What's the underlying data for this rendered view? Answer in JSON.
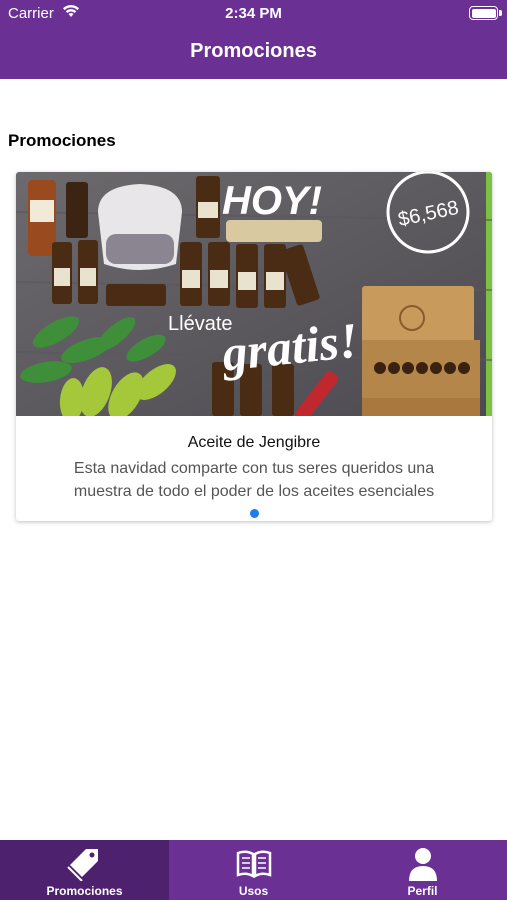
{
  "status_bar": {
    "carrier": "Carrier",
    "time": "2:34 PM"
  },
  "header": {
    "title": "Promociones"
  },
  "section": {
    "title": "Promociones"
  },
  "promo": {
    "image_texts": {
      "headline": "HOY!",
      "price": "$6,568",
      "subtitle": "Llévate",
      "highlight": "gratis!"
    },
    "title": "Aceite de Jengibre",
    "description": "Esta navidad comparte con tus seres queridos una muestra de todo el poder de los aceites esenciales"
  },
  "tabs": [
    {
      "label": "Promociones",
      "icon": "tag-icon",
      "active": true
    },
    {
      "label": "Usos",
      "icon": "book-icon",
      "active": false
    },
    {
      "label": "Perfil",
      "icon": "user-icon",
      "active": false
    }
  ],
  "colors": {
    "primary": "#6a3093",
    "active_tab": "#4e216e",
    "page_dot": "#1e7cf0"
  }
}
